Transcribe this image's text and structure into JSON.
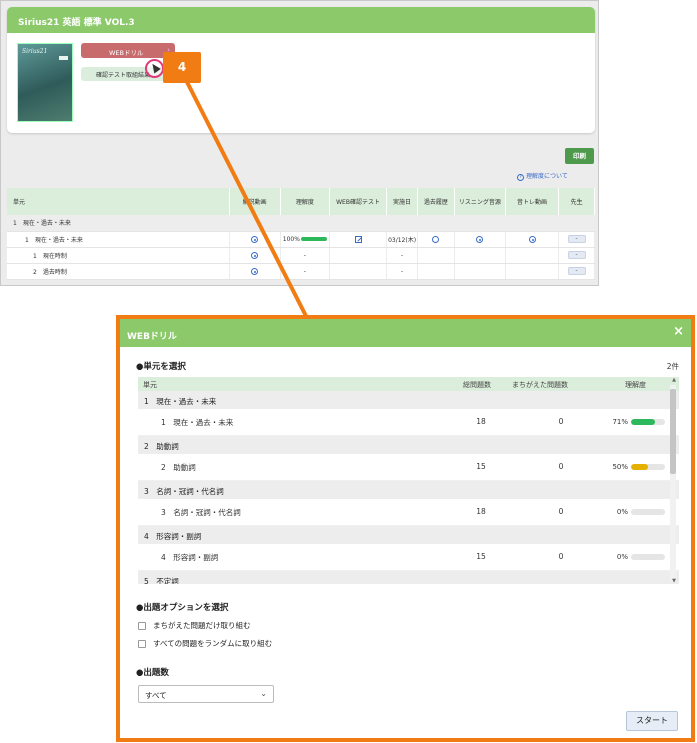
{
  "book": {
    "title": "Sirius21 英語 標準 VOL.3",
    "cover_text": "Sirius21",
    "web_drill_label": "WEBドリル",
    "confirm_test_label": "確認テスト取組結果"
  },
  "toolbar": {
    "print_label": "印刷",
    "understanding_link": "理解度について"
  },
  "unit_table": {
    "headers": [
      "単元",
      "解説動画",
      "理解度",
      "WEB確認テスト",
      "実施日",
      "過去履歴",
      "リスニング音源",
      "音トレ動画",
      "先生"
    ],
    "rows": [
      {
        "kind": "section",
        "label": "1　現在・過去・未来"
      },
      {
        "kind": "row",
        "label": "1　現在・過去・未来",
        "progress": "100%",
        "date": "03/12(木)",
        "teacher": "-"
      },
      {
        "kind": "row",
        "label": "1　現在時制",
        "progress": "-",
        "date": "-",
        "teacher": "-"
      },
      {
        "kind": "row",
        "label": "2　過去時制",
        "progress": "-",
        "date": "-",
        "teacher": "-"
      }
    ]
  },
  "callout": {
    "step": "4"
  },
  "modal": {
    "title": "WEBドリル",
    "close": "×",
    "select_unit_title": "●単元を選択",
    "count_label": "2件",
    "list_headers": {
      "unit": "単元",
      "total": "総問題数",
      "wrong": "まちがえた問題数",
      "understanding": "理解度"
    },
    "units": [
      {
        "section": "1　現在・過去・未来",
        "item": "1　現在・過去・未来",
        "total": "18",
        "wrong": "0",
        "pct": "71%",
        "fill": 0.71,
        "color": "#2eb85c"
      },
      {
        "section": "2　助動詞",
        "item": "2　助動詞",
        "total": "15",
        "wrong": "0",
        "pct": "50%",
        "fill": 0.5,
        "color": "#e6b000"
      },
      {
        "section": "3　名詞・冠詞・代名詞",
        "item": "3　名詞・冠詞・代名詞",
        "total": "18",
        "wrong": "0",
        "pct": "0%",
        "fill": 0,
        "color": "#2eb85c"
      },
      {
        "section": "4　形容詞・副詞",
        "item": "4　形容詞・副詞",
        "total": "15",
        "wrong": "0",
        "pct": "0%",
        "fill": 0,
        "color": "#2eb85c"
      },
      {
        "section": "5　不定詞"
      }
    ],
    "options_title": "●出題オプションを選択",
    "option_wrong_only": "まちがえた問題だけ取り組む",
    "option_random": "すべての問題をランダムに取り組む",
    "question_count_title": "●出題数",
    "question_count_value": "すべて",
    "start_label": "スタート"
  }
}
